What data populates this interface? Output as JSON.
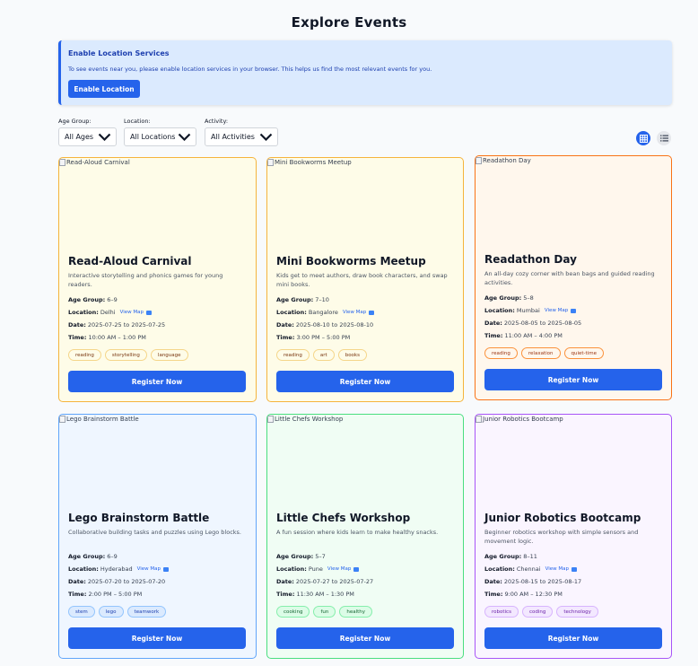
{
  "page": {
    "title": "Explore Events"
  },
  "location_banner": {
    "title": "Enable Location Services",
    "text": "To see events near you, please enable location services in your browser. This helps us find the most relevant events for you.",
    "button": "Enable Location"
  },
  "filters": {
    "age_group": {
      "label": "Age Group:",
      "value": "All Ages"
    },
    "location": {
      "label": "Location:",
      "value": "All Locations"
    },
    "activity": {
      "label": "Activity:",
      "value": "All Activities"
    }
  },
  "view_toggle": {
    "active": "grid"
  },
  "labels": {
    "age_group": "Age Group:",
    "location": "Location:",
    "date": "Date:",
    "time": "Time:",
    "view_map": "View Map",
    "register": "Register Now"
  },
  "colors": {
    "primary": "#2563eb",
    "amber_border": "#f5b43c",
    "orange_border": "#f97316",
    "blue_border": "#60a5fa",
    "green_border": "#4ade80",
    "purple_border": "#a855f7"
  },
  "events": [
    {
      "title": "Read-Aloud Carnival",
      "image_alt": "Read-Aloud Carnival",
      "description": "Interactive storytelling and phonics games for young readers.",
      "age_group": "6–9",
      "location": "Delhi",
      "date": "2025-07-25 to 2025-07-25",
      "time": "10:00 AM – 1:00 PM",
      "tags": [
        "reading",
        "storytelling",
        "language"
      ]
    },
    {
      "title": "Mini Bookworms Meetup",
      "image_alt": "Mini Bookworms Meetup",
      "description": "Kids get to meet authors, draw book characters, and swap mini books.",
      "age_group": "7–10",
      "location": "Bangalore",
      "date": "2025-08-10 to 2025-08-10",
      "time": "3:00 PM – 5:00 PM",
      "tags": [
        "reading",
        "art",
        "books"
      ]
    },
    {
      "title": "Readathon Day",
      "image_alt": "Readathon Day",
      "description": "An all-day cozy corner with bean bags and guided reading activities.",
      "age_group": "5–8",
      "location": "Mumbai",
      "date": "2025-08-05 to 2025-08-05",
      "time": "11:00 AM – 4:00 PM",
      "tags": [
        "reading",
        "relaxation",
        "quiet-time"
      ]
    },
    {
      "title": "Lego Brainstorm Battle",
      "image_alt": "Lego Brainstorm Battle",
      "description": "Collaborative building tasks and puzzles using Lego blocks.",
      "age_group": "6–9",
      "location": "Hyderabad",
      "date": "2025-07-20 to 2025-07-20",
      "time": "2:00 PM – 5:00 PM",
      "tags": [
        "stem",
        "lego",
        "teamwork"
      ]
    },
    {
      "title": "Little Chefs Workshop",
      "image_alt": "Little Chefs Workshop",
      "description": "A fun session where kids learn to make healthy snacks.",
      "age_group": "5–7",
      "location": "Pune",
      "date": "2025-07-27 to 2025-07-27",
      "time": "11:30 AM – 1:30 PM",
      "tags": [
        "cooking",
        "fun",
        "healthy"
      ]
    },
    {
      "title": "Junior Robotics Bootcamp",
      "image_alt": "Junior Robotics Bootcamp",
      "description": "Beginner robotics workshop with simple sensors and movement logic.",
      "age_group": "8–11",
      "location": "Chennai",
      "date": "2025-08-15 to 2025-08-17",
      "time": "9:00 AM – 12:30 PM",
      "tags": [
        "robotics",
        "coding",
        "technology"
      ]
    }
  ]
}
